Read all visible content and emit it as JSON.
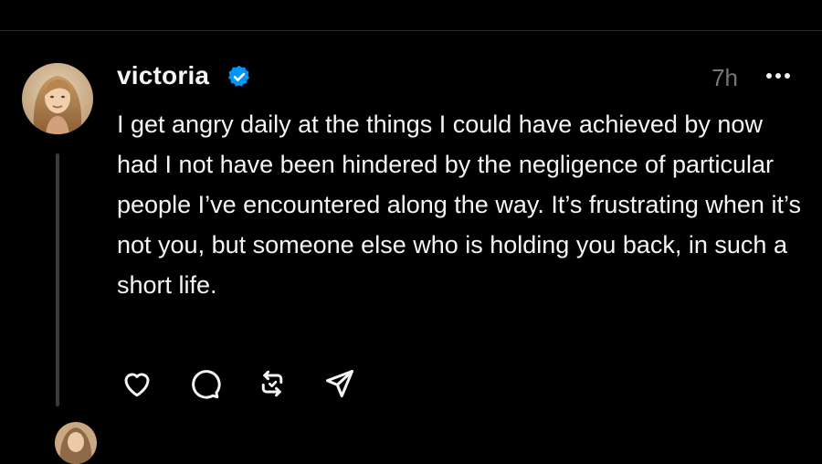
{
  "colors": {
    "background": "#000000",
    "text_primary": "#f3f5f7",
    "text_secondary": "#777777",
    "verified_blue": "#0095f6",
    "thread_line": "#3a3a3a"
  },
  "post": {
    "username": "victoria",
    "verified": true,
    "timestamp": "7h",
    "text": "I get angry daily at the things I could have achieved by now had I not have been hindered by the negligence of particular people I’ve encountered along the way. It’s frustrating when it’s not you, but someone else who is holding you back, in such a short life.",
    "icons": {
      "avatar": "profile-photo",
      "verified": "verified-badge-icon",
      "more": "more-horizontal-icon",
      "like": "heart-icon",
      "reply": "comment-icon",
      "repost": "repost-icon",
      "share": "send-icon"
    }
  }
}
